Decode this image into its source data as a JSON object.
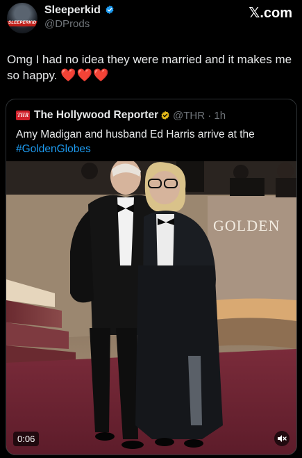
{
  "author": {
    "display_name": "Sleeperkid",
    "handle": "@DProds",
    "avatar_badge": "SLEEPERKID"
  },
  "brand": {
    "prefix": "𝕏",
    "label": ".com"
  },
  "tweet": {
    "text": "Omg I had no idea they were married and it makes me so happy.",
    "hearts": "❤️❤️❤️"
  },
  "quote": {
    "logo_text": "THR",
    "name": "The Hollywood Reporter",
    "meta": "@THR · 1h",
    "text": "Amy Madigan and husband Ed Harris arrive at the",
    "hashtag": "#GoldenGlobes"
  },
  "video": {
    "backdrop_text": "GOLDEN",
    "duration": "0:06",
    "mute_icon": "muted-speaker-icon"
  },
  "colors": {
    "background": "#000000",
    "text_primary": "#e7e9ea",
    "text_secondary": "#71767b",
    "verified_blue": "#1d9bf0",
    "verified_gold": "#e2b719",
    "link_blue": "#1d9bf0",
    "heart_red": "#e8262b",
    "thr_red": "#d01f2a"
  }
}
